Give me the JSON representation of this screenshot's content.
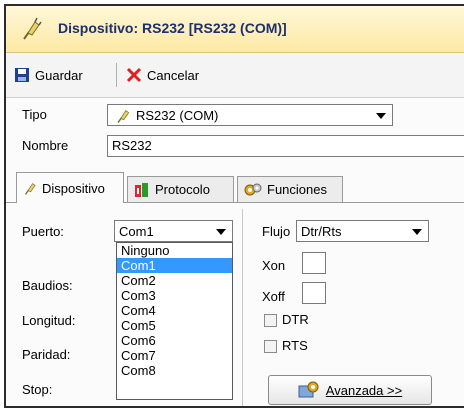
{
  "window": {
    "title": "Dispositivo: RS232 [RS232 (COM)]"
  },
  "toolbar": {
    "save_label": "Guardar",
    "cancel_label": "Cancelar"
  },
  "form": {
    "tipo_label": "Tipo",
    "tipo_value": "RS232 (COM)",
    "nombre_label": "Nombre",
    "nombre_value": "RS232"
  },
  "tabs": [
    {
      "label": "Dispositivo",
      "icon": "plug-icon",
      "active": true
    },
    {
      "label": "Protocolo",
      "icon": "protocol-icon",
      "active": false
    },
    {
      "label": "Funciones",
      "icon": "gears-icon",
      "active": false
    }
  ],
  "device": {
    "puerto_label": "Puerto:",
    "puerto_value": "Com1",
    "baudios_label": "Baudios:",
    "longitud_label": "Longitud:",
    "paridad_label": "Paridad:",
    "stop_label": "Stop:",
    "flujo_label": "Flujo",
    "flujo_value": "Dtr/Rts",
    "xon_label": "Xon",
    "xoff_label": "Xoff",
    "dtr_label": "DTR",
    "rts_label": "RTS",
    "advanced_label": "Avanzada >>"
  },
  "port_options": [
    "Ninguno",
    "Com1",
    "Com2",
    "Com3",
    "Com4",
    "Com5",
    "Com6",
    "Com7",
    "Com8"
  ],
  "port_selected_index": 1,
  "colors": {
    "selection": "#3399ff",
    "title_text": "#1c2f6e"
  }
}
